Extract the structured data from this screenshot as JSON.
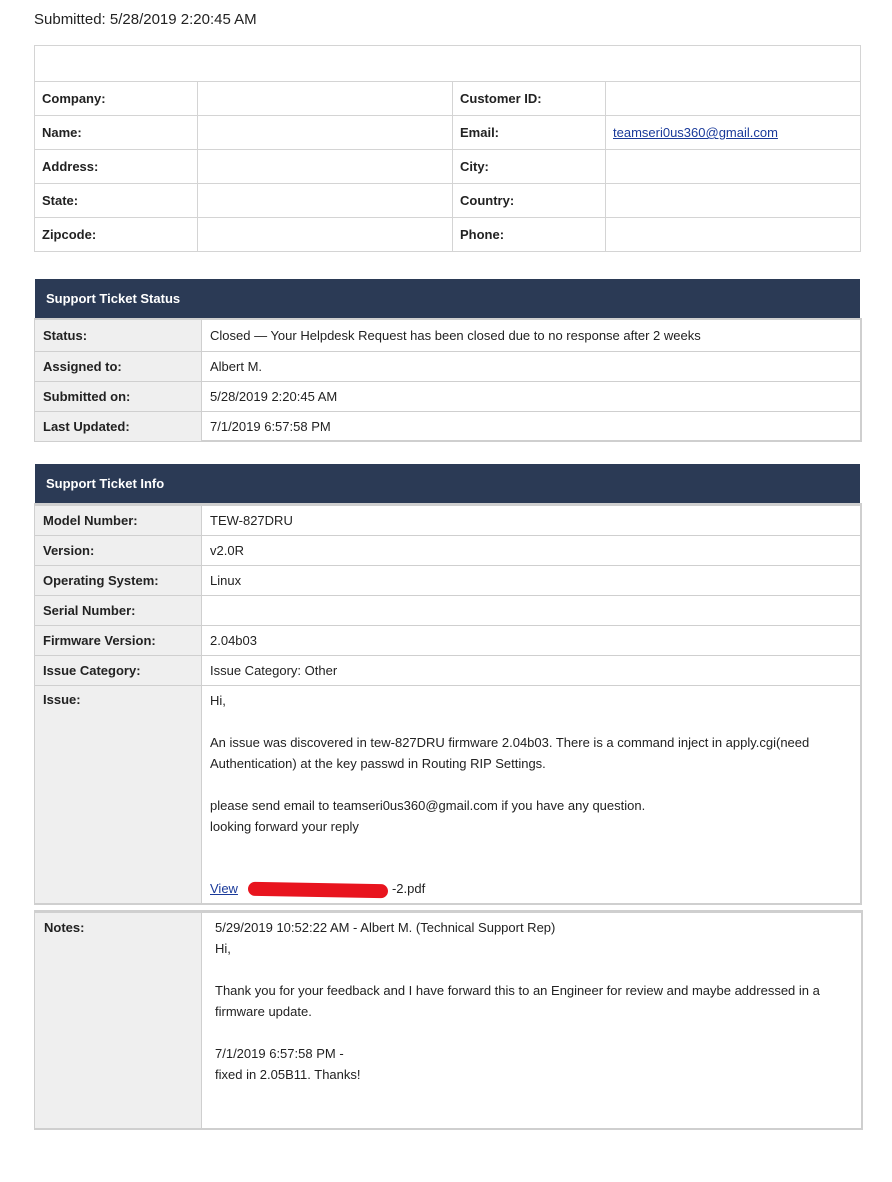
{
  "submitted": "Submitted: 5/28/2019 2:20:45 AM",
  "customer": {
    "rows": [
      {
        "l1": "Company:",
        "v1": "",
        "l2": "Customer ID:",
        "v2": ""
      },
      {
        "l1": "Name:",
        "v1": "",
        "l2": "Email:",
        "v2": "teamseri0us360@gmail.com"
      },
      {
        "l1": "Address:",
        "v1": "",
        "l2": "City:",
        "v2": ""
      },
      {
        "l1": "State:",
        "v1": "",
        "l2": "Country:",
        "v2": ""
      },
      {
        "l1": "Zipcode:",
        "v1": "",
        "l2": "Phone:",
        "v2": ""
      }
    ]
  },
  "status_panel": {
    "title": "Support Ticket Status",
    "rows": [
      {
        "label": "Status:",
        "value": "Closed — Your Helpdesk Request has been closed due to no response after 2 weeks"
      },
      {
        "label": "Assigned to:",
        "value": "Albert M."
      },
      {
        "label": "Submitted on:",
        "value": "5/28/2019 2:20:45 AM"
      },
      {
        "label": "Last Updated:",
        "value": "7/1/2019 6:57:58 PM"
      }
    ]
  },
  "info_panel": {
    "title": "Support Ticket Info",
    "rows": [
      {
        "label": "Model Number:",
        "value": "TEW-827DRU"
      },
      {
        "label": "Version:",
        "value": "v2.0R"
      },
      {
        "label": "Operating System:",
        "value": "Linux"
      },
      {
        "label": "Serial Number:",
        "value": ""
      },
      {
        "label": "Firmware Version:",
        "value": "2.04b03"
      },
      {
        "label": "Issue Category:",
        "value": "Issue Category: Other"
      }
    ],
    "issue": {
      "label": "Issue:",
      "greeting": "Hi,",
      "p1": "An issue was discovered in tew-827DRU firmware 2.04b03. There is a command inject in apply.cgi(need Authentication) at the key passwd in Routing RIP Settings.",
      "p2a": "please send email to teamseri0us360@gmail.com if you have any question.",
      "p2b": "looking forward your reply",
      "view_link": "View",
      "file_suffix": "-2.pdf"
    }
  },
  "notes": {
    "label": "Notes:",
    "header": "5/29/2019 10:52:22 AM - Albert M. (Technical Support Rep)",
    "greeting": "Hi,",
    "body": "Thank you for your feedback and I have forward this to an Engineer for review and maybe addressed in a firmware update.",
    "update_time": "7/1/2019 6:57:58 PM -",
    "update_text": "fixed in 2.05B11. Thanks!"
  }
}
